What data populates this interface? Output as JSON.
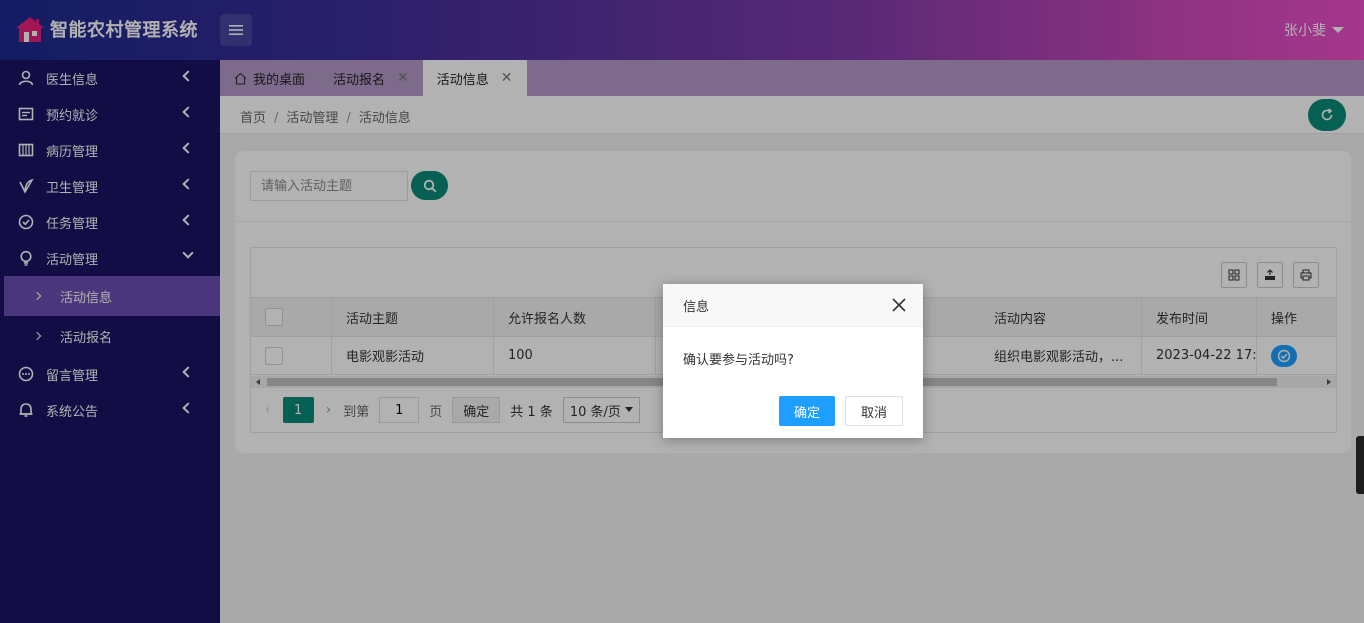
{
  "app": {
    "title": "智能农村管理系统",
    "user_name": "张小斐"
  },
  "sidebar": {
    "items": [
      {
        "label": "医生信息",
        "icon": "user-icon"
      },
      {
        "label": "预约就诊",
        "icon": "calendar-icon"
      },
      {
        "label": "病历管理",
        "icon": "record-icon"
      },
      {
        "label": "卫生管理",
        "icon": "leaf-icon"
      },
      {
        "label": "任务管理",
        "icon": "check-circle-icon"
      },
      {
        "label": "活动管理",
        "icon": "bulb-icon",
        "expanded": true
      },
      {
        "label": "留言管理",
        "icon": "message-icon"
      },
      {
        "label": "系统公告",
        "icon": "bell-icon"
      }
    ],
    "sub_items": [
      {
        "label": "活动信息",
        "active": true
      },
      {
        "label": "活动报名",
        "active": false
      }
    ]
  },
  "tabs": [
    {
      "label": "我的桌面",
      "closable": false
    },
    {
      "label": "活动报名",
      "closable": true
    },
    {
      "label": "活动信息",
      "closable": true,
      "active": true
    }
  ],
  "breadcrumb": [
    "首页",
    "活动管理",
    "活动信息"
  ],
  "search": {
    "placeholder": "请输入活动主题",
    "value": ""
  },
  "table": {
    "columns": [
      "活动主题",
      "允许报名人数",
      "活动内容",
      "发布时间",
      "操作"
    ],
    "rows": [
      {
        "title": "电影观影活动",
        "capacity": "100",
        "content": "组织电影观影活动，...",
        "published": "2023-04-22 17:32:"
      }
    ]
  },
  "pager": {
    "current": "1",
    "goto_label": "到第",
    "goto_value": "1",
    "page_label": "页",
    "ok_label": "确定",
    "total": "共 1 条",
    "page_size": "10 条/页"
  },
  "dialog": {
    "title": "信息",
    "message": "确认要参与活动吗?",
    "confirm": "确定",
    "cancel": "取消"
  },
  "colors": {
    "accent": "#0a8a78",
    "primary": "#1e9fff",
    "sidebar": "#1b1464",
    "sidebar_active": "#6a4fb0",
    "tabs_bar": "#b59ac9"
  }
}
